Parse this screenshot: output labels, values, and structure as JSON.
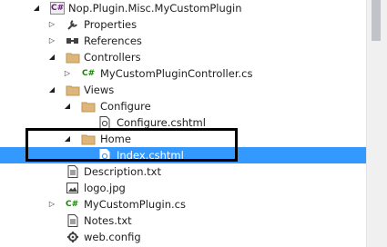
{
  "tree": {
    "items": [
      {
        "label": "Nop.Plugin.Misc.MyCustomPlugin",
        "icon": "csharp-project-icon",
        "expander": "expanded"
      },
      {
        "label": "Properties",
        "icon": "wrench-icon",
        "expander": "collapsed"
      },
      {
        "label": "References",
        "icon": "references-icon",
        "expander": "collapsed"
      },
      {
        "label": "Controllers",
        "icon": "folder-icon",
        "expander": "expanded"
      },
      {
        "label": "MyCustomPluginController.cs",
        "icon": "csharp-file-icon",
        "expander": "collapsed"
      },
      {
        "label": "Views",
        "icon": "folder-icon",
        "expander": "expanded"
      },
      {
        "label": "Configure",
        "icon": "folder-icon",
        "expander": "expanded"
      },
      {
        "label": "Configure.cshtml",
        "icon": "cshtml-file-icon",
        "expander": "none"
      },
      {
        "label": "Home",
        "icon": "folder-icon",
        "expander": "expanded"
      },
      {
        "label": "Index.cshtml",
        "icon": "cshtml-file-icon",
        "expander": "none",
        "selected": true
      },
      {
        "label": "Description.txt",
        "icon": "text-file-icon",
        "expander": "none"
      },
      {
        "label": "logo.jpg",
        "icon": "image-file-icon",
        "expander": "none"
      },
      {
        "label": "MyCustomPlugin.cs",
        "icon": "csharp-file-icon",
        "expander": "collapsed"
      },
      {
        "label": "Notes.txt",
        "icon": "text-file-icon",
        "expander": "none"
      },
      {
        "label": "web.config",
        "icon": "config-file-icon",
        "expander": "none"
      }
    ]
  },
  "glyphs": {
    "csharp": "C#"
  },
  "colors": {
    "selection": "#3399ff",
    "folder": "#dcb67a",
    "highlight_box": "#000000"
  }
}
